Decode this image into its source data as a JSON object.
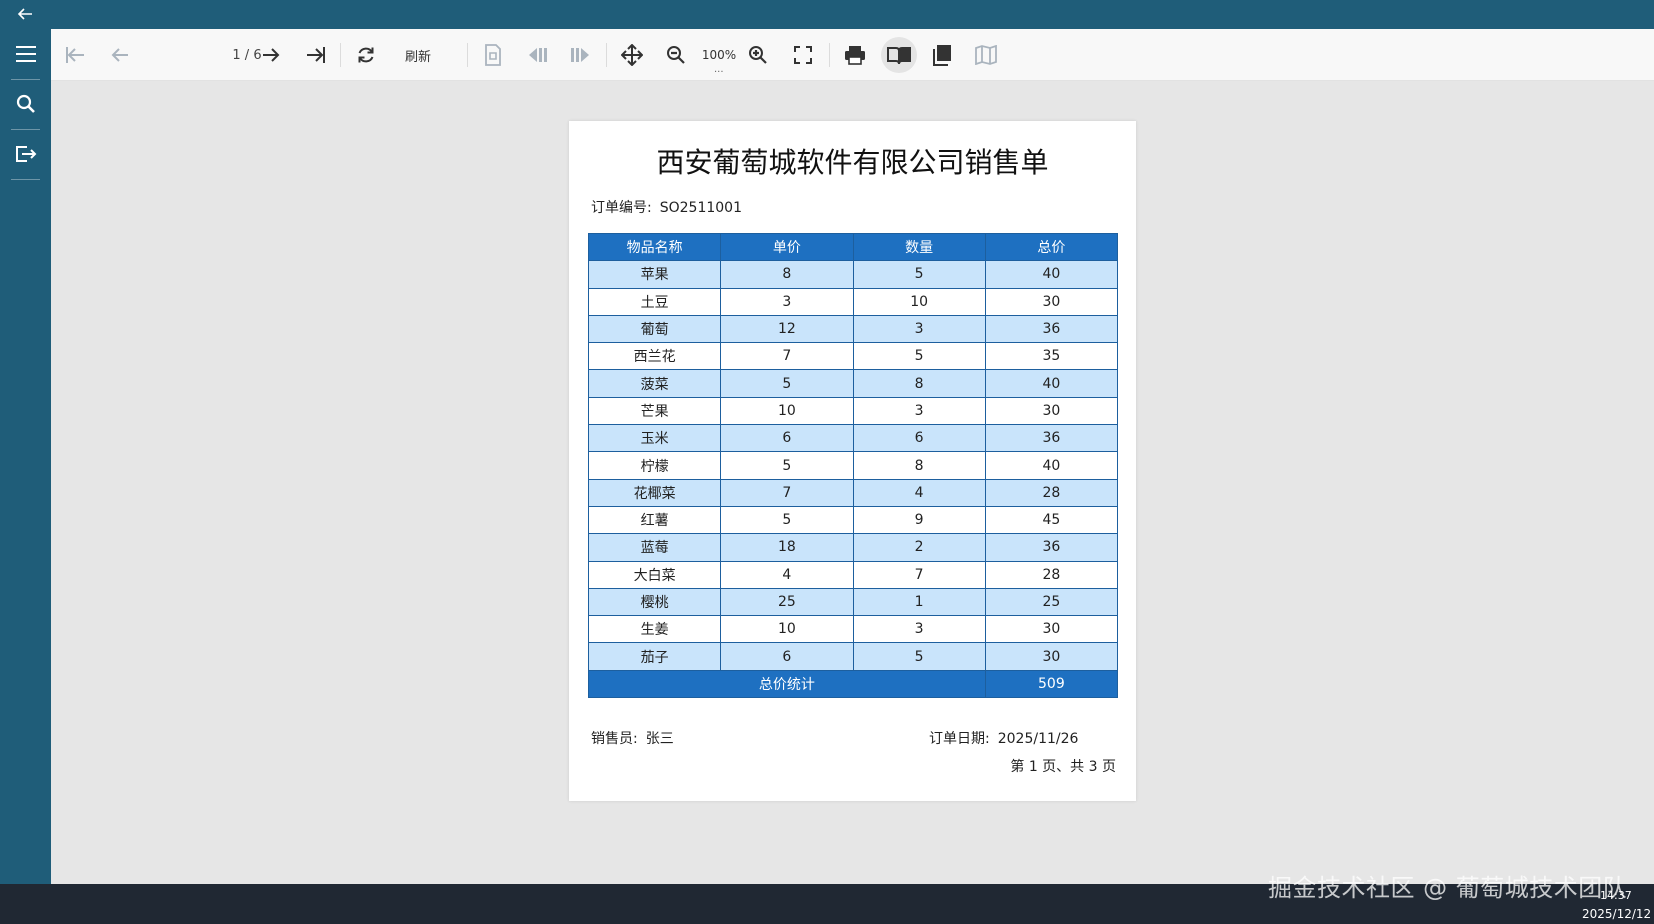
{
  "toolbar": {
    "page_indicator": "1 / 6",
    "refresh_label": "刷新",
    "zoom_level": "100%",
    "zoom_more": "..."
  },
  "report": {
    "title": "西安葡萄城软件有限公司销售单",
    "order_no_label": "订单编号:",
    "order_no": "SO2511001",
    "columns": [
      "物品名称",
      "单价",
      "数量",
      "总价"
    ],
    "rows": [
      {
        "name": "苹果",
        "price": "8",
        "qty": "5",
        "total": "40"
      },
      {
        "name": "土豆",
        "price": "3",
        "qty": "10",
        "total": "30"
      },
      {
        "name": "葡萄",
        "price": "12",
        "qty": "3",
        "total": "36"
      },
      {
        "name": "西兰花",
        "price": "7",
        "qty": "5",
        "total": "35"
      },
      {
        "name": "菠菜",
        "price": "5",
        "qty": "8",
        "total": "40"
      },
      {
        "name": "芒果",
        "price": "10",
        "qty": "3",
        "total": "30"
      },
      {
        "name": "玉米",
        "price": "6",
        "qty": "6",
        "total": "36"
      },
      {
        "name": "柠檬",
        "price": "5",
        "qty": "8",
        "total": "40"
      },
      {
        "name": "花椰菜",
        "price": "7",
        "qty": "4",
        "total": "28"
      },
      {
        "name": "红薯",
        "price": "5",
        "qty": "9",
        "total": "45"
      },
      {
        "name": "蓝莓",
        "price": "18",
        "qty": "2",
        "total": "36"
      },
      {
        "name": "大白菜",
        "price": "4",
        "qty": "7",
        "total": "28"
      },
      {
        "name": "樱桃",
        "price": "25",
        "qty": "1",
        "total": "25"
      },
      {
        "name": "生姜",
        "price": "10",
        "qty": "3",
        "total": "30"
      },
      {
        "name": "茄子",
        "price": "6",
        "qty": "5",
        "total": "30"
      }
    ],
    "total_label": "总价统计",
    "total_value": "509",
    "salesman_label": "销售员:",
    "salesman": "张三",
    "order_date_label": "订单日期:",
    "order_date": "2025/11/26",
    "page_footer": "第 1 页、共 3 页"
  },
  "watermark": "掘金技术社区 @ 葡萄城技术团队",
  "taskbar": {
    "time": "14:37",
    "date": "2025/12/12"
  },
  "colors": {
    "chrome": "#1f5d79",
    "header_blue": "#1e70c1",
    "row_alt": "#c9e4fb",
    "taskbar": "#202833"
  }
}
